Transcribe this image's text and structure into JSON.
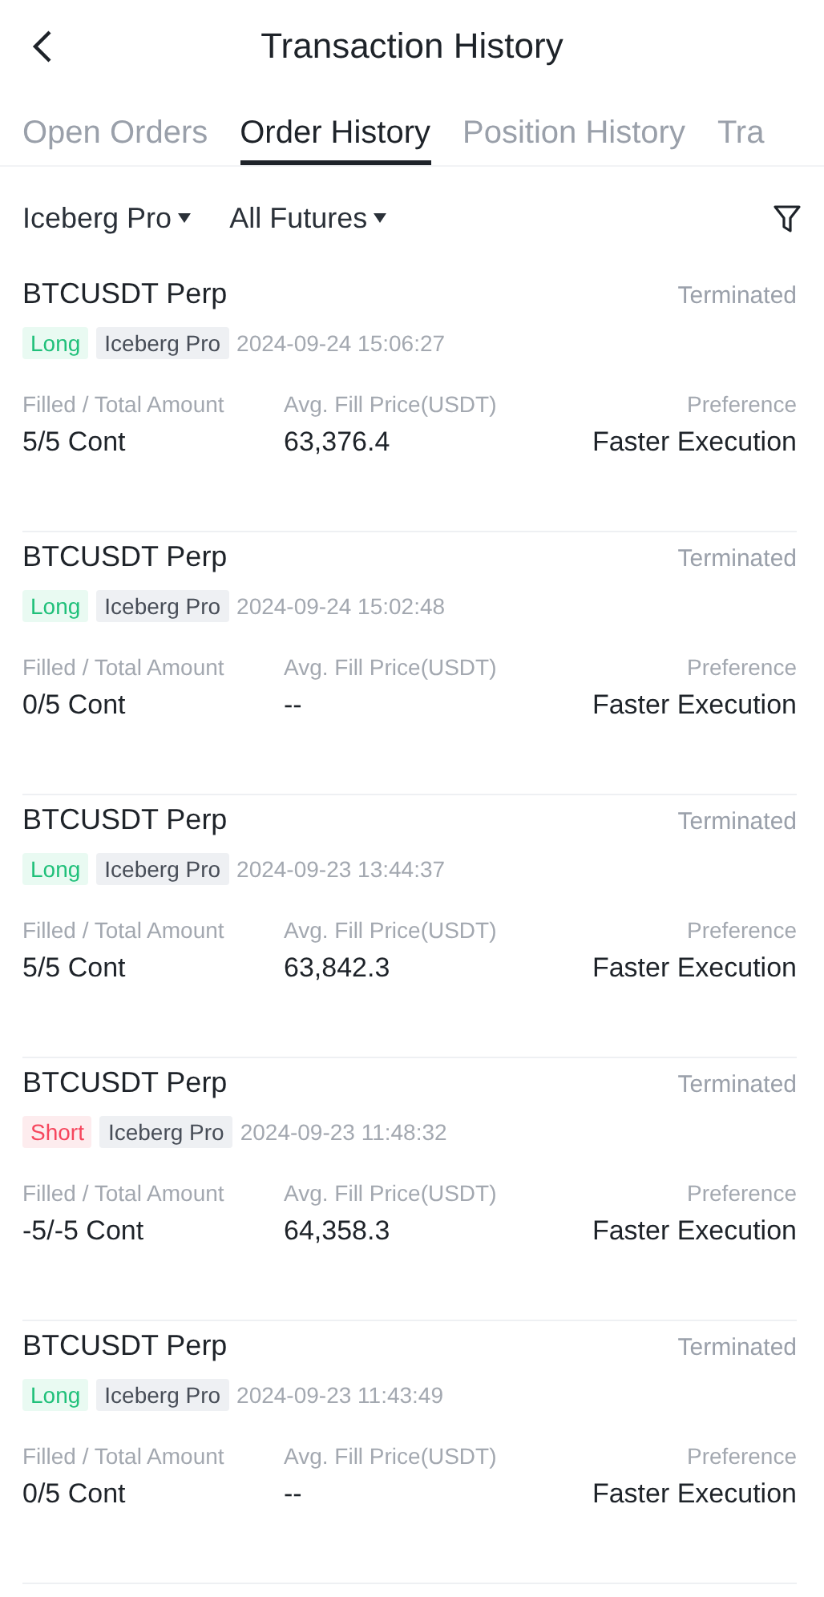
{
  "header": {
    "title": "Transaction History"
  },
  "tabs": [
    {
      "label": "Open Orders",
      "selected": false
    },
    {
      "label": "Order History",
      "selected": true
    },
    {
      "label": "Position History",
      "selected": false
    },
    {
      "label": "Tra",
      "selected": false
    }
  ],
  "filters": [
    {
      "label": "Iceberg Pro"
    },
    {
      "label": "All Futures"
    }
  ],
  "orders": [
    {
      "symbol": "BTCUSDT Perp",
      "status": "Terminated",
      "side": {
        "label": "Long",
        "kind": "long"
      },
      "type": "Iceberg Pro",
      "time": "2024-09-24 15:06:27",
      "amount_label": "Filled / Total Amount",
      "amount": "5/5 Cont",
      "price_label": "Avg. Fill Price(USDT)",
      "price": "63,376.4",
      "preference_label": "Preference",
      "preference": "Faster Execution"
    },
    {
      "symbol": "BTCUSDT Perp",
      "status": "Terminated",
      "side": {
        "label": "Long",
        "kind": "long"
      },
      "type": "Iceberg Pro",
      "time": "2024-09-24 15:02:48",
      "amount_label": "Filled / Total Amount",
      "amount": "0/5 Cont",
      "price_label": "Avg. Fill Price(USDT)",
      "price": "--",
      "preference_label": "Preference",
      "preference": "Faster Execution"
    },
    {
      "symbol": "BTCUSDT Perp",
      "status": "Terminated",
      "side": {
        "label": "Long",
        "kind": "long"
      },
      "type": "Iceberg Pro",
      "time": "2024-09-23 13:44:37",
      "amount_label": "Filled / Total Amount",
      "amount": "5/5 Cont",
      "price_label": "Avg. Fill Price(USDT)",
      "price": "63,842.3",
      "preference_label": "Preference",
      "preference": "Faster Execution"
    },
    {
      "symbol": "BTCUSDT Perp",
      "status": "Terminated",
      "side": {
        "label": "Short",
        "kind": "short"
      },
      "type": "Iceberg Pro",
      "time": "2024-09-23 11:48:32",
      "amount_label": "Filled / Total Amount",
      "amount": "-5/-5 Cont",
      "price_label": "Avg. Fill Price(USDT)",
      "price": "64,358.3",
      "preference_label": "Preference",
      "preference": "Faster Execution"
    },
    {
      "symbol": "BTCUSDT Perp",
      "status": "Terminated",
      "side": {
        "label": "Long",
        "kind": "long"
      },
      "type": "Iceberg Pro",
      "time": "2024-09-23 11:43:49",
      "amount_label": "Filled / Total Amount",
      "amount": "0/5 Cont",
      "price_label": "Avg. Fill Price(USDT)",
      "price": "--",
      "preference_label": "Preference",
      "preference": "Faster Execution"
    }
  ]
}
